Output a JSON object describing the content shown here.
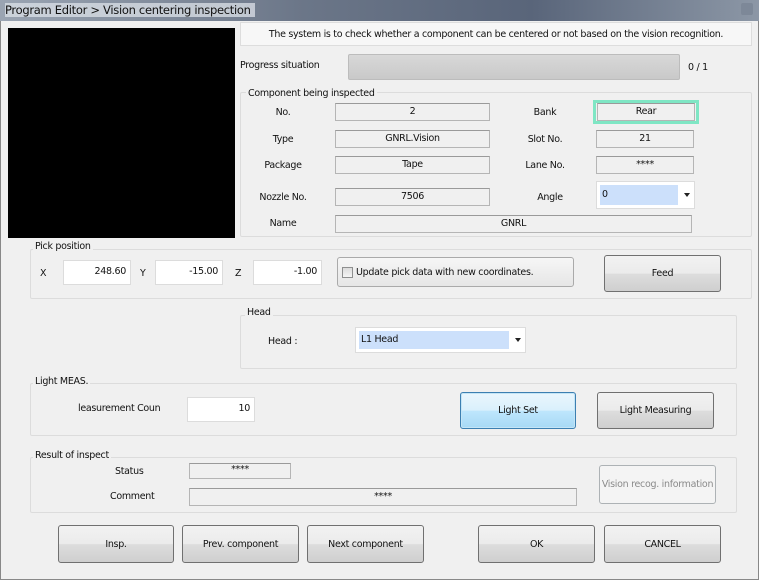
{
  "window": {
    "title": "Program Editor > Vision centering inspection"
  },
  "info_text": "The system is to check whether a component can be centered or not based on the vision recognition.",
  "progress": {
    "label": "Progress situation",
    "value": 0,
    "total": 1,
    "text": "0 / 1"
  },
  "component": {
    "group_label": "Component being inspected",
    "no_label": "No.",
    "no": "2",
    "bank_label": "Bank",
    "bank": "Rear",
    "type_label": "Type",
    "type": "GNRL.Vision",
    "slot_label": "Slot No.",
    "slot": "21",
    "package_label": "Package",
    "package": "Tape",
    "lane_label": "Lane No.",
    "lane": "****",
    "nozzle_label": "Nozzle No.",
    "nozzle": "7506",
    "angle_label": "Angle",
    "angle": "0",
    "name_label": "Name",
    "name": "GNRL"
  },
  "pick": {
    "group_label": "Pick position",
    "x_label": "X",
    "x": "248.60",
    "y_label": "Y",
    "y": "-15.00",
    "z_label": "Z",
    "z": "-1.00",
    "update_label": "Update pick data with new coordinates.",
    "feed": "Feed"
  },
  "head": {
    "group_label": "Head",
    "label": "Head :",
    "value": "L1 Head"
  },
  "light": {
    "group_label": "Light MEAS.",
    "count_label": "leasurement Coun",
    "count": "10",
    "light_set": "Light Set",
    "light_measuring": "Light Measuring"
  },
  "result": {
    "group_label": "Result of inspect",
    "status_label": "Status",
    "status": "****",
    "comment_label": "Comment",
    "comment": "****",
    "vision_info": "Vision recog. information"
  },
  "buttons": {
    "insp": "Insp.",
    "prev": "Prev. component",
    "next": "Next component",
    "ok": "OK",
    "cancel": "CANCEL"
  }
}
